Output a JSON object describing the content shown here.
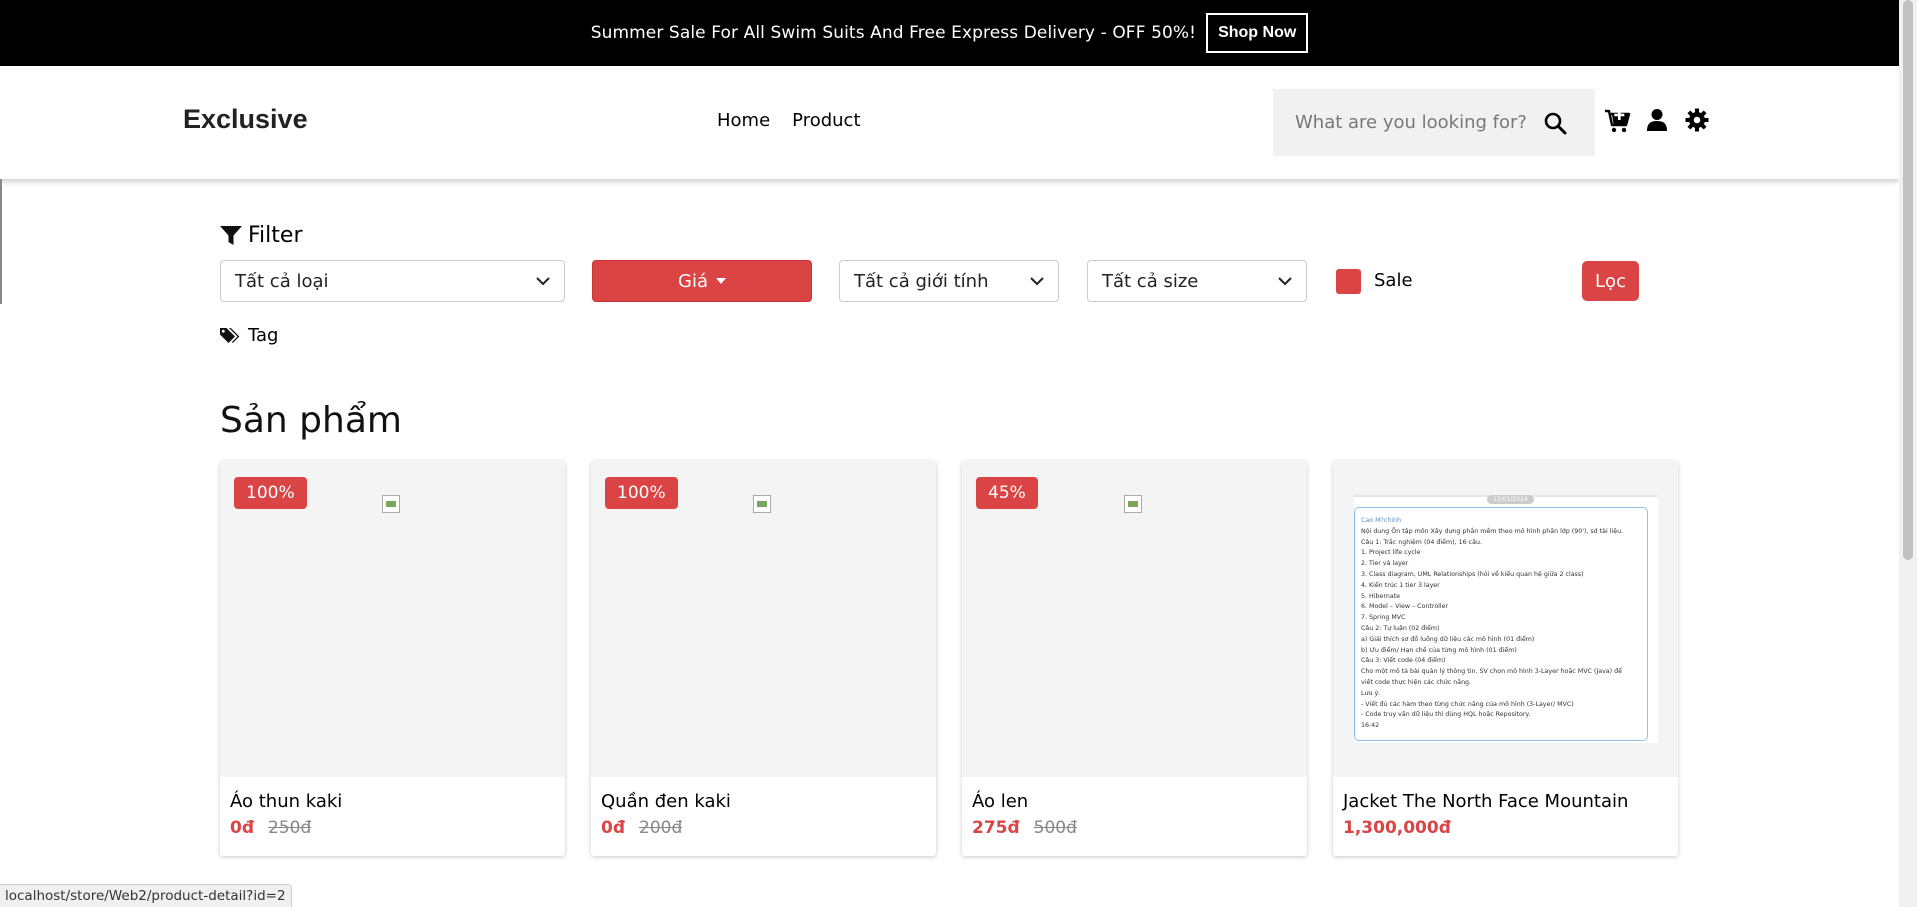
{
  "topbar": {
    "message": "Summer Sale For All Swim Suits And Free Express Delivery - OFF 50%!",
    "button_label": "Shop Now"
  },
  "header": {
    "logo": "Exclusive",
    "nav": [
      {
        "label": "Home"
      },
      {
        "label": "Product"
      }
    ],
    "search_placeholder": "What are you looking for?",
    "icons": [
      "search-icon",
      "cart-plus-icon",
      "user-icon",
      "gear-icon"
    ]
  },
  "filter": {
    "title": "Filter",
    "category_select": "Tất cả loại",
    "price_button": "Giá",
    "gender_select": "Tất cả giới tính",
    "size_select": "Tất cả size",
    "sale_label": "Sale",
    "apply_button": "Lọc",
    "tag_label": "Tag"
  },
  "products_section": {
    "title": "Sản phẩm",
    "items": [
      {
        "name": "Áo thun kaki",
        "badge": "100%",
        "price": "0đ",
        "old_price": "250đ"
      },
      {
        "name": "Quần đen kaki",
        "badge": "100%",
        "price": "0đ",
        "old_price": "200đ"
      },
      {
        "name": "Áo len",
        "badge": "45%",
        "price": "275đ",
        "old_price": "500đ"
      },
      {
        "name": "Jacket The North Face Mountain",
        "badge": "",
        "price": "1,300,000đ",
        "old_price": ""
      }
    ]
  },
  "doc_preview": {
    "date": "13/01/2024",
    "sender": "Cao M?chinh",
    "lines": [
      "Nội dung Ôn tập môn Xây dựng phần mềm theo mô hình phân lớp (90'), sd tài liệu.",
      "Câu 1: Trắc nghiệm (04 điểm), 16 câu.",
      "1. Project life cycle",
      "2. Tier và layer",
      "3. Class diagram, UML Relationships (hỏi về kiểu quan hệ giữa 2 class)",
      "4. Kiến trúc 1 tier 3 layer",
      "5. Hibernate",
      "6. Model – View – Controller",
      "7. Spring MVC",
      "Câu 2: Tự luận (02 điểm)",
      "a)    Giải thích sơ đồ luồng dữ liệu các mô hình (01 điểm)",
      "b)    Ưu điểm/ Hạn chế của từng mô hình (01 điểm)",
      "Câu 3: Viết code (04 điểm)",
      "Cho một mô tả bài quản lý thông tin. SV chọn mô hình 3-Layer hoặc MVC (Java) để",
      "viết code thực hiện các chức năng.",
      "Lưu ý:",
      "-       Viết đủ các hàm theo từng chức năng của mô hình (3-Layer/ MVC)",
      "-       Code truy vấn dữ liệu thì dùng HQL hoặc Repository.",
      "16:42"
    ]
  },
  "status_bar": {
    "url": "localhost/store/Web2/product-detail?id=2"
  },
  "colors": {
    "accent": "#db4444",
    "topbar_bg": "#000000"
  }
}
